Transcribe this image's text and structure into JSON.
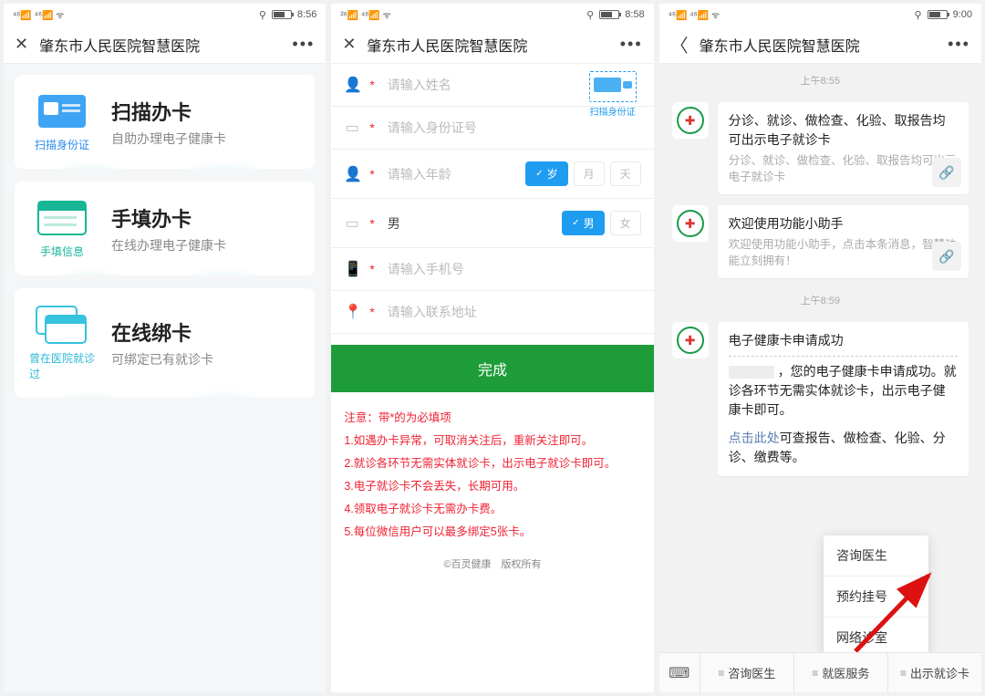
{
  "s1": {
    "status_time": "8:56",
    "title": "肇东市人民医院智慧医院",
    "cards": [
      {
        "icon_label": "扫描身份证",
        "heading": "扫描办卡",
        "sub": "自助办理电子健康卡"
      },
      {
        "icon_label": "手填信息",
        "heading": "手填办卡",
        "sub": "在线办理电子健康卡"
      },
      {
        "icon_label": "曾在医院就诊过",
        "heading": "在线绑卡",
        "sub": "可绑定已有就诊卡"
      }
    ]
  },
  "s2": {
    "status_time": "8:58",
    "title": "肇东市人民医院智慧医院",
    "scan_label": "扫描身份证",
    "rows": {
      "name_ph": "请输入姓名",
      "id_ph": "请输入身份证号",
      "age_ph": "请输入年龄",
      "age_unit_sui": "岁",
      "age_unit_yue": "月",
      "age_unit_tian": "天",
      "gender_value": "男",
      "gender_m": "男",
      "gender_f": "女",
      "phone_ph": "请输入手机号",
      "addr_ph": "请输入联系地址"
    },
    "submit": "完成",
    "notes_title": "注意：带*的为必填项",
    "notes": [
      "1.如遇办卡异常，可取消关注后，重新关注即可。",
      "2.就诊各环节无需实体就诊卡，出示电子就诊卡即可。",
      "3.电子就诊卡不会丢失，长期可用。",
      "4.领取电子就诊卡无需办卡费。",
      "5.每位微信用户可以最多绑定5张卡。"
    ],
    "copyright": "©百灵健康　版权所有"
  },
  "s3": {
    "status_time": "9:00",
    "title": "肇东市人民医院智慧医院",
    "ts1": "上午8:55",
    "ts2": "上午8:59",
    "msg1": {
      "title": "分诊、就诊、做检查、化验、取报告均可出示电子就诊卡",
      "sub": "分诊、就诊、做检查、化验、取报告均可出示电子就诊卡"
    },
    "msg2": {
      "title": "欢迎使用功能小助手",
      "sub": "欢迎使用功能小助手，点击本条消息，智慧功能立刻拥有！"
    },
    "msg3": {
      "title": "电子健康卡申请成功",
      "body1": "，您的电子健康卡申请成功。就诊各环节无需实体就诊卡，出示电子健康卡即可。",
      "link_prefix": "点击此处",
      "link_tail": "可查报告、做检查、化验、分诊、缴费等。"
    },
    "menu": [
      "咨询医生",
      "预约挂号",
      "网络诊室"
    ],
    "bottom": [
      "咨询医生",
      "就医服务",
      "出示就诊卡"
    ]
  }
}
